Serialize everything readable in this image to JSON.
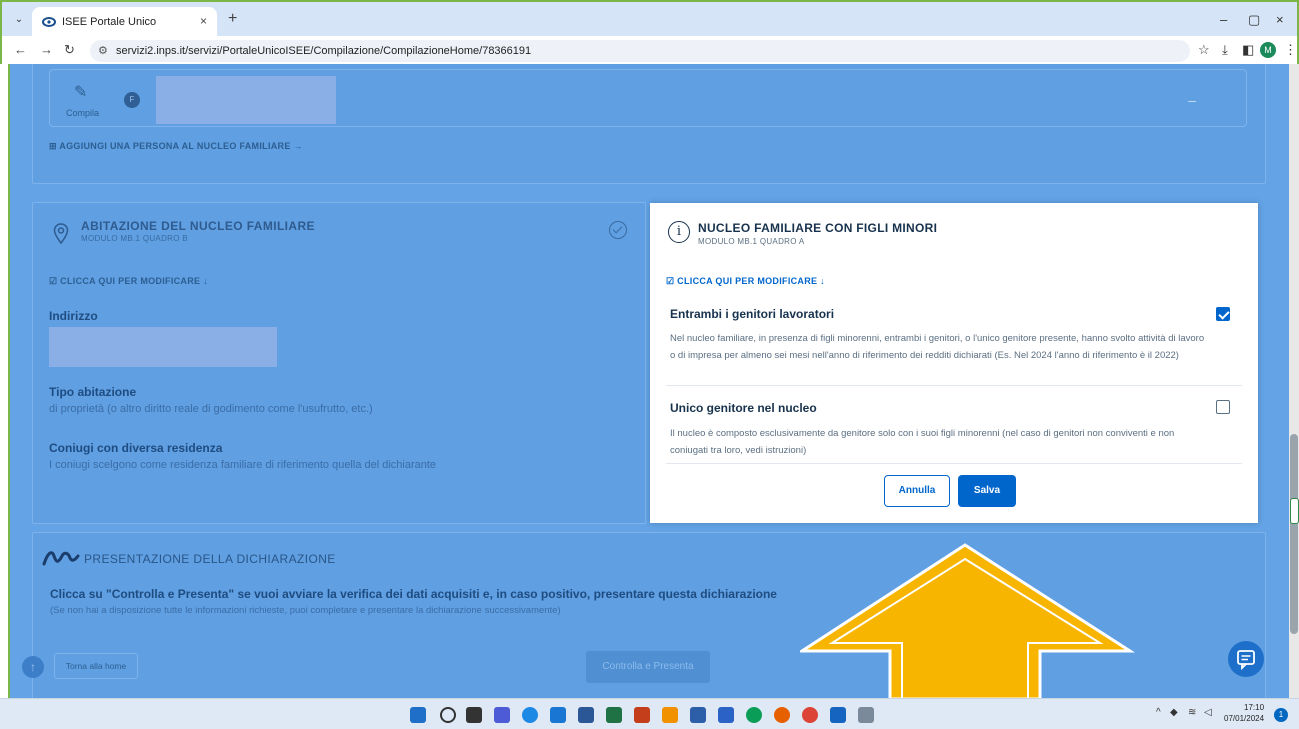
{
  "browser": {
    "tab_title": "ISEE Portale Unico",
    "tab_close": "×",
    "new_tab": "+",
    "url": "servizi2.inps.it/servizi/PortaleUnicoISEE/Compilazione/CompilazioneHome/78366191",
    "profile_initial": "M",
    "win_minimize": "–",
    "win_restore": "▢",
    "win_close": "×"
  },
  "family_section": {
    "compila_label": "Compila",
    "member_badge": "F",
    "collapse_symbol": "–",
    "add_person_link": "⊞ AGGIUNGI UNA PERSONA AL NUCLEO FAMILIARE →"
  },
  "abitazione": {
    "title": "ABITAZIONE DEL NUCLEO FAMILIARE",
    "subtitle": "MODULO MB.1 QUADRO B",
    "edit_link": "☑ CLICCA QUI PER MODIFICARE ↓",
    "indirizzo_label": "Indirizzo",
    "tipo_label": "Tipo abitazione",
    "tipo_value": "di proprietà (o altro diritto reale di godimento come l'usufrutto, etc.)",
    "coniugi_label": "Coniugi con diversa residenza",
    "coniugi_value": "I coniugi scelgono come residenza familiare di riferimento quella del dichiarante"
  },
  "modal": {
    "title": "NUCLEO FAMILIARE CON FIGLI MINORI",
    "subtitle": "MODULO MB.1 QUADRO A",
    "edit_link": "☑ CLICCA QUI PER MODIFICARE ↓",
    "options": [
      {
        "label": "Entrambi i genitori lavoratori",
        "checked": true,
        "description": "Nel nucleo familiare, in presenza di figli minorenni, entrambi i genitori, o l'unico genitore presente, hanno svolto attività di lavoro o di impresa per almeno sei mesi nell'anno di riferimento dei redditi dichiarati (Es. Nel 2024 l'anno di riferimento è il 2022)"
      },
      {
        "label": "Unico genitore nel nucleo",
        "checked": false,
        "description": "Il nucleo è composto esclusivamente da genitore solo con i suoi figli minorenni (nel caso di genitori non conviventi e non coniugati tra loro, vedi istruzioni)"
      }
    ],
    "cancel_label": "Annulla",
    "save_label": "Salva"
  },
  "presentazione": {
    "title": "PRESENTAZIONE DELLA DICHIARAZIONE",
    "question": "Clicca su \"Controlla e Presenta\" se vuoi avviare la verifica dei dati acquisiti e, in caso positivo, presentare questa dichiarazione",
    "note": "(Se non hai a disposizione tutte le informazioni richieste, puoi completare e presentare la dichiarazione successivamente)",
    "home_button": "Torna alla home",
    "submit_button": "Controlla e Presenta"
  },
  "taskbar": {
    "time": "17:10",
    "date": "07/01/2024",
    "notifications": "1"
  },
  "colors": {
    "accent": "#0066cc",
    "overlay_arrow": "#f7b500"
  }
}
